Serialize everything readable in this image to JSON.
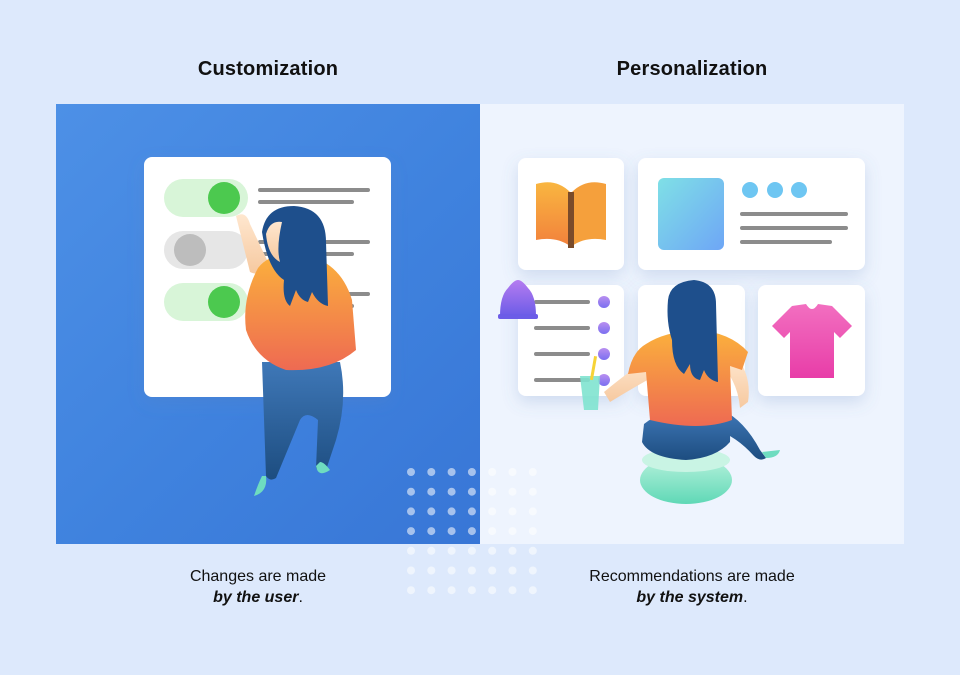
{
  "left": {
    "title": "Customization",
    "caption_line1": "Changes are made",
    "caption_emphasis": "by the user",
    "caption_end": "."
  },
  "right": {
    "title": "Personalization",
    "caption_line1": "Recommendations are made",
    "caption_emphasis": "by the system",
    "caption_end": "."
  },
  "colors": {
    "background": "#dde9fc",
    "left_panel": "#4289e0",
    "right_panel": "#eef4fe",
    "toggle_on": "#4cc94f",
    "toggle_off": "#bdbdbd",
    "shirt_orange": "#f7a23a",
    "hair": "#1e4f8c",
    "pants": "#3a6fae"
  },
  "icons": [
    "toggle-switch-icon",
    "book-icon",
    "bell-icon",
    "t-shirt-icon",
    "image-thumbnail-icon",
    "drink-cup-icon"
  ]
}
